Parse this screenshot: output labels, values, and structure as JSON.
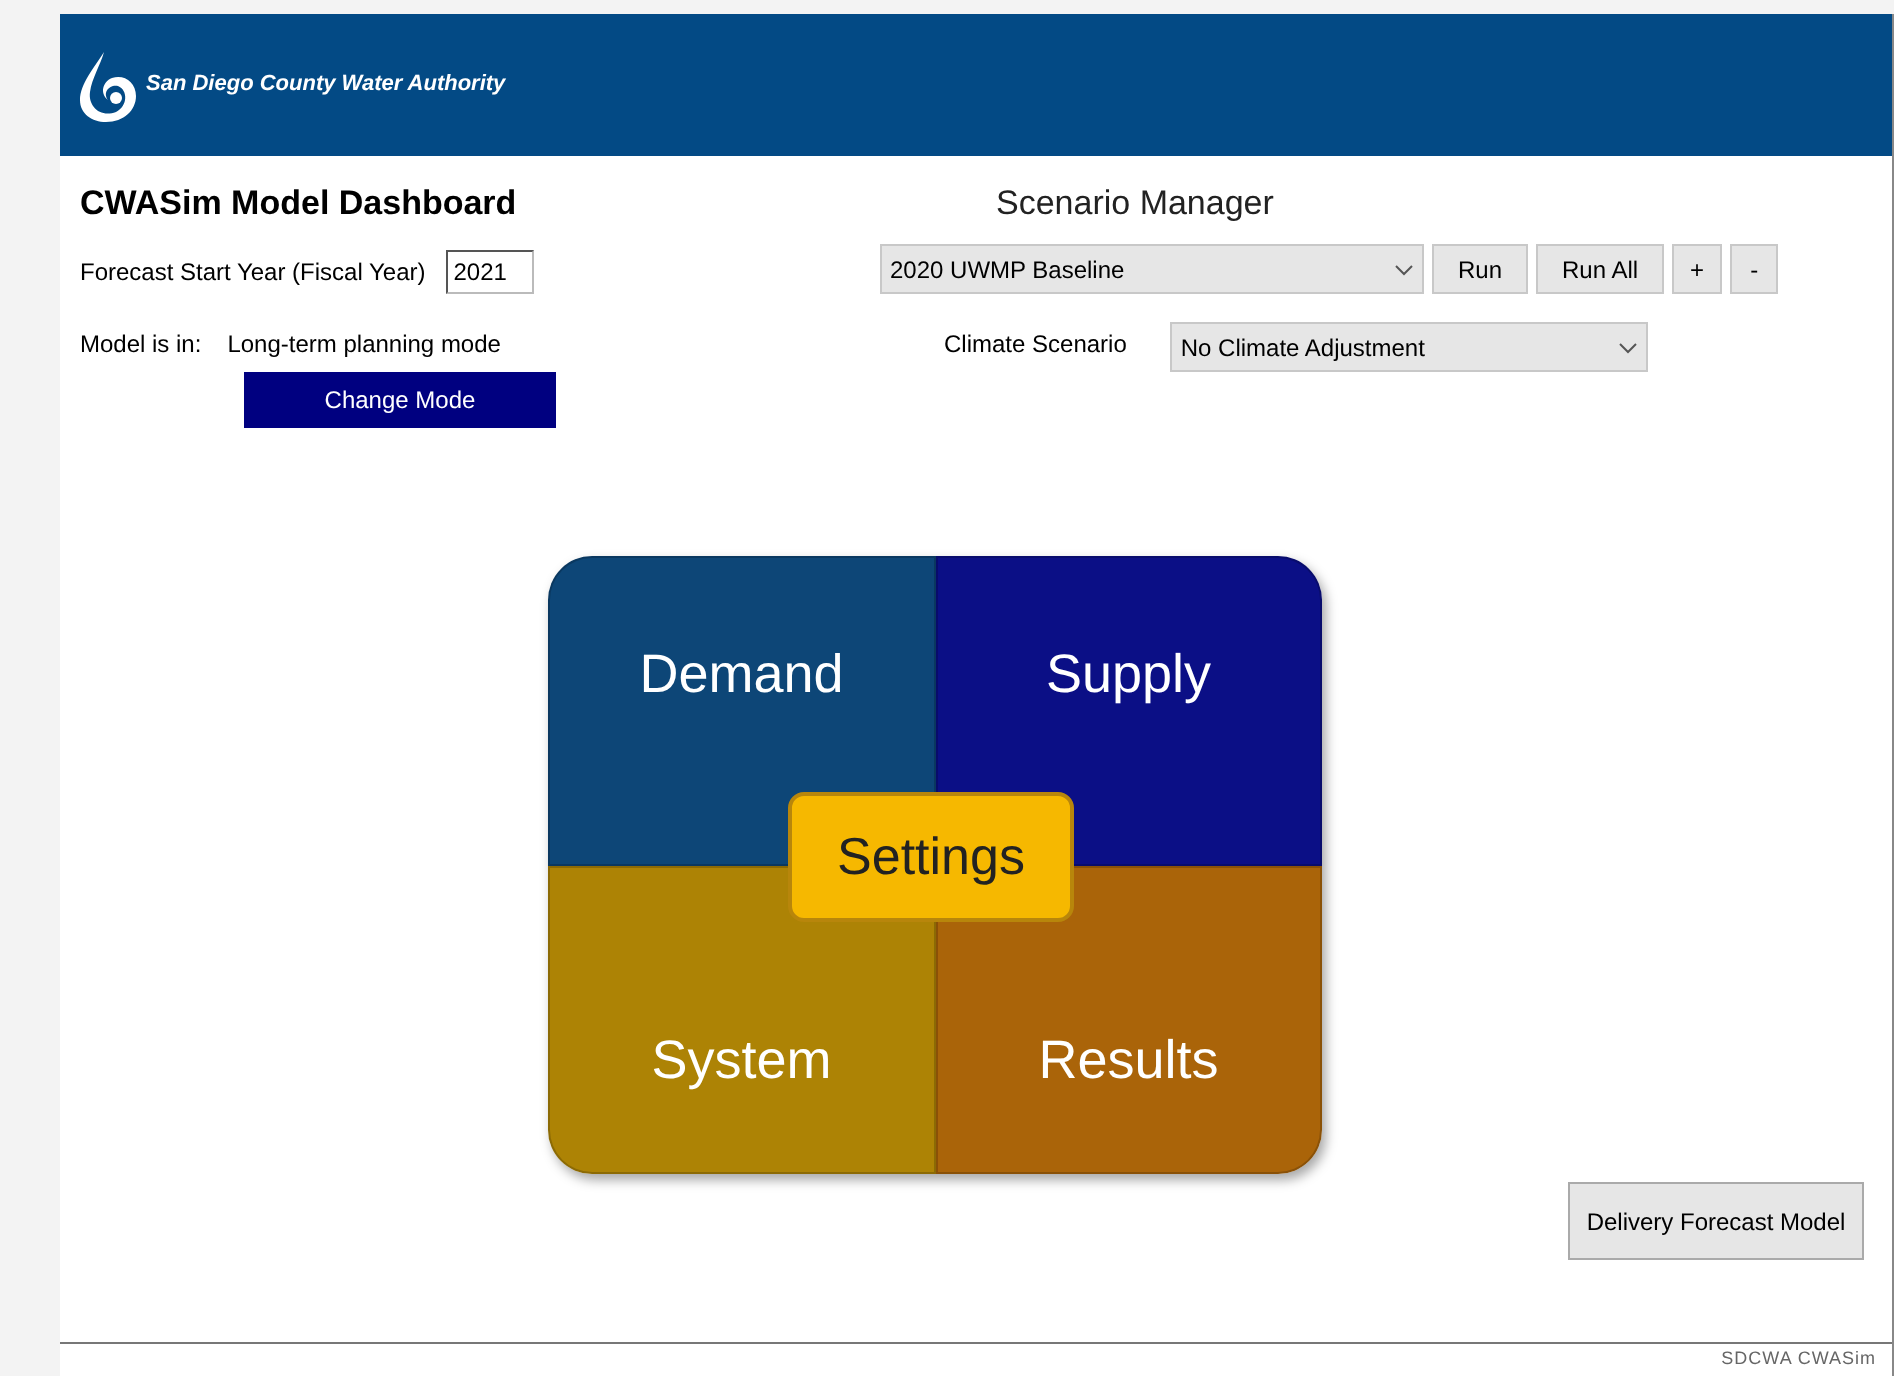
{
  "header": {
    "org_name": "San Diego County Water Authority"
  },
  "title": "CWASim Model Dashboard",
  "forecast": {
    "label": "Forecast Start Year (Fiscal Year)",
    "value": "2021"
  },
  "mode": {
    "label": "Model is in:",
    "value": "Long-term planning mode",
    "button": "Change Mode"
  },
  "scenario_manager": {
    "title": "Scenario Manager",
    "scenario": "2020 UWMP Baseline",
    "buttons": [
      "Run",
      "Run All",
      "+",
      "-"
    ],
    "climate_label": "Climate Scenario",
    "climate_value": "No Climate Adjustment"
  },
  "tiles": [
    {
      "label": "Demand",
      "color": "#0d4677"
    },
    {
      "label": "Supply",
      "color": "#0b0f86"
    },
    {
      "label": "System",
      "color": "#ad8305"
    },
    {
      "label": "Results",
      "color": "#aa6409"
    }
  ],
  "center_tile": {
    "label": "Settings",
    "color": "#f6b800"
  },
  "delivery_button": "Delivery Forecast Model",
  "footer": "SDCWA CWASim"
}
